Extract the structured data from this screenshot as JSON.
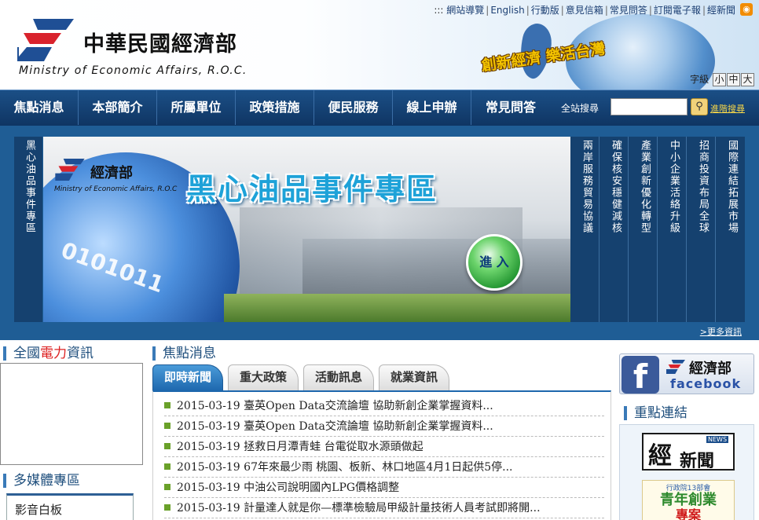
{
  "header": {
    "logo_cn": "中華民國經濟部",
    "logo_en": "Ministry of Economic Affairs, R.O.C.",
    "slogan": "創新經濟 樂活台灣",
    "top_links_prefix": ":::",
    "top_links": [
      "網站導覽",
      "English",
      "行動版",
      "意見信箱",
      "常見問答",
      "訂閱電子報",
      "經新聞"
    ],
    "font_size_label": "字級",
    "font_sizes": [
      "小",
      "中",
      "大"
    ]
  },
  "nav": {
    "items": [
      "焦點消息",
      "本部簡介",
      "所屬單位",
      "政策措施",
      "便民服務",
      "線上申辦",
      "常見問答"
    ],
    "search_label": "全站搜尋",
    "search_value": "",
    "advanced_search": "進階搜尋"
  },
  "banner": {
    "left_label": "黑心油品事件專區",
    "ministry_cn": "經濟部",
    "ministry_en": "Ministry of Economic Affairs, R.O.C",
    "title": "黑心油品事件專區",
    "binary": "0101011",
    "enter_label": "進 入",
    "right_columns": [
      "兩岸服務貿易協議",
      "確保核安穩健減核",
      "產業創新優化轉型",
      "中小企業活絡升級",
      "招商投資布局全球",
      "國際連結拓展市場"
    ],
    "more_info": ">更多資訊"
  },
  "left": {
    "power_title_pre": "全國",
    "power_title_red": "電力",
    "power_title_post": "資訊",
    "media_title": "多媒體專區",
    "media_item": "影音白板"
  },
  "center": {
    "news_title": "焦點消息",
    "tabs": [
      "即時新聞",
      "重大政策",
      "活動訊息",
      "就業資訊"
    ],
    "news": [
      "2015-03-19 臺英Open Data交流論壇 協助新創企業掌握資料...",
      "2015-03-19 臺英Open Data交流論壇 協助新創企業掌握資料...",
      "2015-03-19 拯救日月潭青蛙 台電從取水源頭做起",
      "2015-03-19 67年來最少雨 桃園、板新、林口地區4月1日起供5停...",
      "2015-03-19 中油公司說明國內LPG價格調整",
      "2015-03-19 計量達人就是你—標準檢驗局甲級計量技術人員考試即將開..."
    ]
  },
  "right": {
    "fb_letter": "f",
    "fb_cn": "經濟部",
    "fb_text": "facebook",
    "links_title": "重點連結",
    "news_logo_big": "經",
    "news_logo_small": "新聞",
    "news_logo_tag": "NEWS",
    "youth_l1": "行政院13部會",
    "youth_l2": "青年創業",
    "youth_l3": "專案"
  },
  "colors": {
    "nav_bg": "#1b4f86",
    "accent_blue": "#1d67ad",
    "link_red": "#d22222",
    "logo_red": "#d9232d"
  }
}
